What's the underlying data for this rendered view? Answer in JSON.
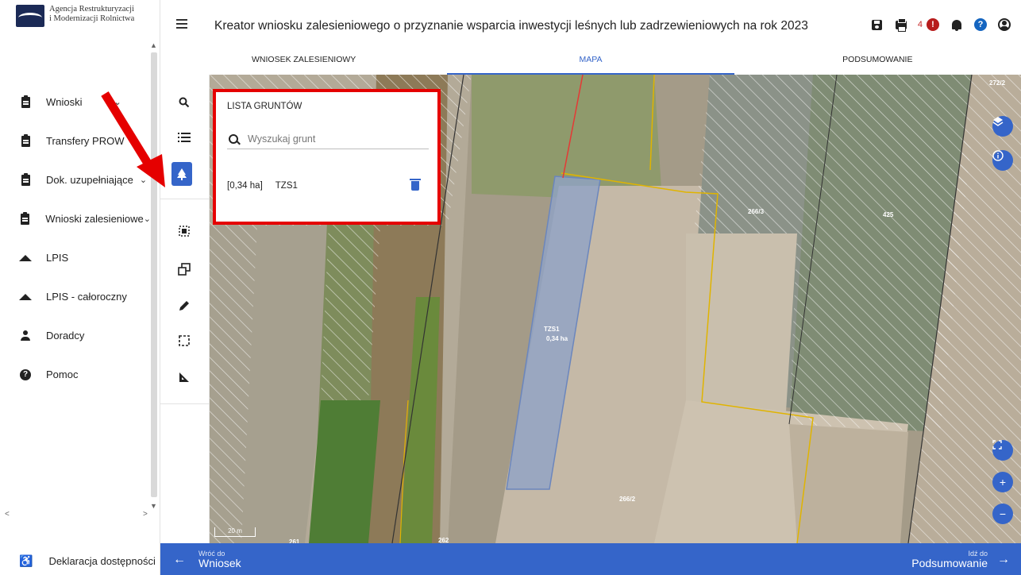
{
  "logo": {
    "line1": "Agencja Restrukturyzacji",
    "line2": "i Modernizacji Rolnictwa"
  },
  "sidebar": {
    "items": [
      {
        "label": "Wnioski",
        "icon": "clipboard-icon",
        "chevron": "⌄"
      },
      {
        "label": "Transfery PROW",
        "icon": "clipboard-icon"
      },
      {
        "label": "Dok. uzupełniające",
        "icon": "clipboard-icon",
        "chevron": "⌄"
      },
      {
        "label": "Wnioski zalesieniowe",
        "icon": "clipboard-icon",
        "chevron": "⌄"
      },
      {
        "label": "LPIS",
        "icon": "mountain-icon"
      },
      {
        "label": "LPIS - całoroczny",
        "icon": "mountain-icon"
      },
      {
        "label": "Doradcy",
        "icon": "person-icon"
      },
      {
        "label": "Pomoc",
        "icon": "help-icon"
      }
    ],
    "accessibility_label": "Deklaracja dostępności"
  },
  "header": {
    "title": "Kreator wniosku zalesieniowego o przyznanie wsparcia inwestycji leśnych lub zadrzewieniowych na rok 2023",
    "notification_count": "4",
    "alert_glyph": "!",
    "help_glyph": "?"
  },
  "tabs": [
    {
      "label": "WNIOSEK ZALESIENIOWY",
      "active": false
    },
    {
      "label": "MAPA",
      "active": true
    },
    {
      "label": "PODSUMOWANIE",
      "active": false
    }
  ],
  "panel": {
    "title": "LISTA GRUNTÓW",
    "search_placeholder": "Wyszukaj grunt",
    "rows": [
      {
        "area": "[0,34 ha]",
        "name": "TZS1"
      }
    ]
  },
  "map": {
    "labels": [
      "272/2",
      "266/3",
      "425",
      "TZS1",
      "0,34 ha",
      "266/2",
      "262",
      "261"
    ],
    "scale": "20 m"
  },
  "bottombar": {
    "back_small": "Wróć do",
    "back_big": "Wniosek",
    "next_small": "Idź do",
    "next_big": "Podsumowanie"
  },
  "colors": {
    "accent": "#3565c9",
    "highlight": "#e50000",
    "parcel_border": "#e0b400"
  }
}
